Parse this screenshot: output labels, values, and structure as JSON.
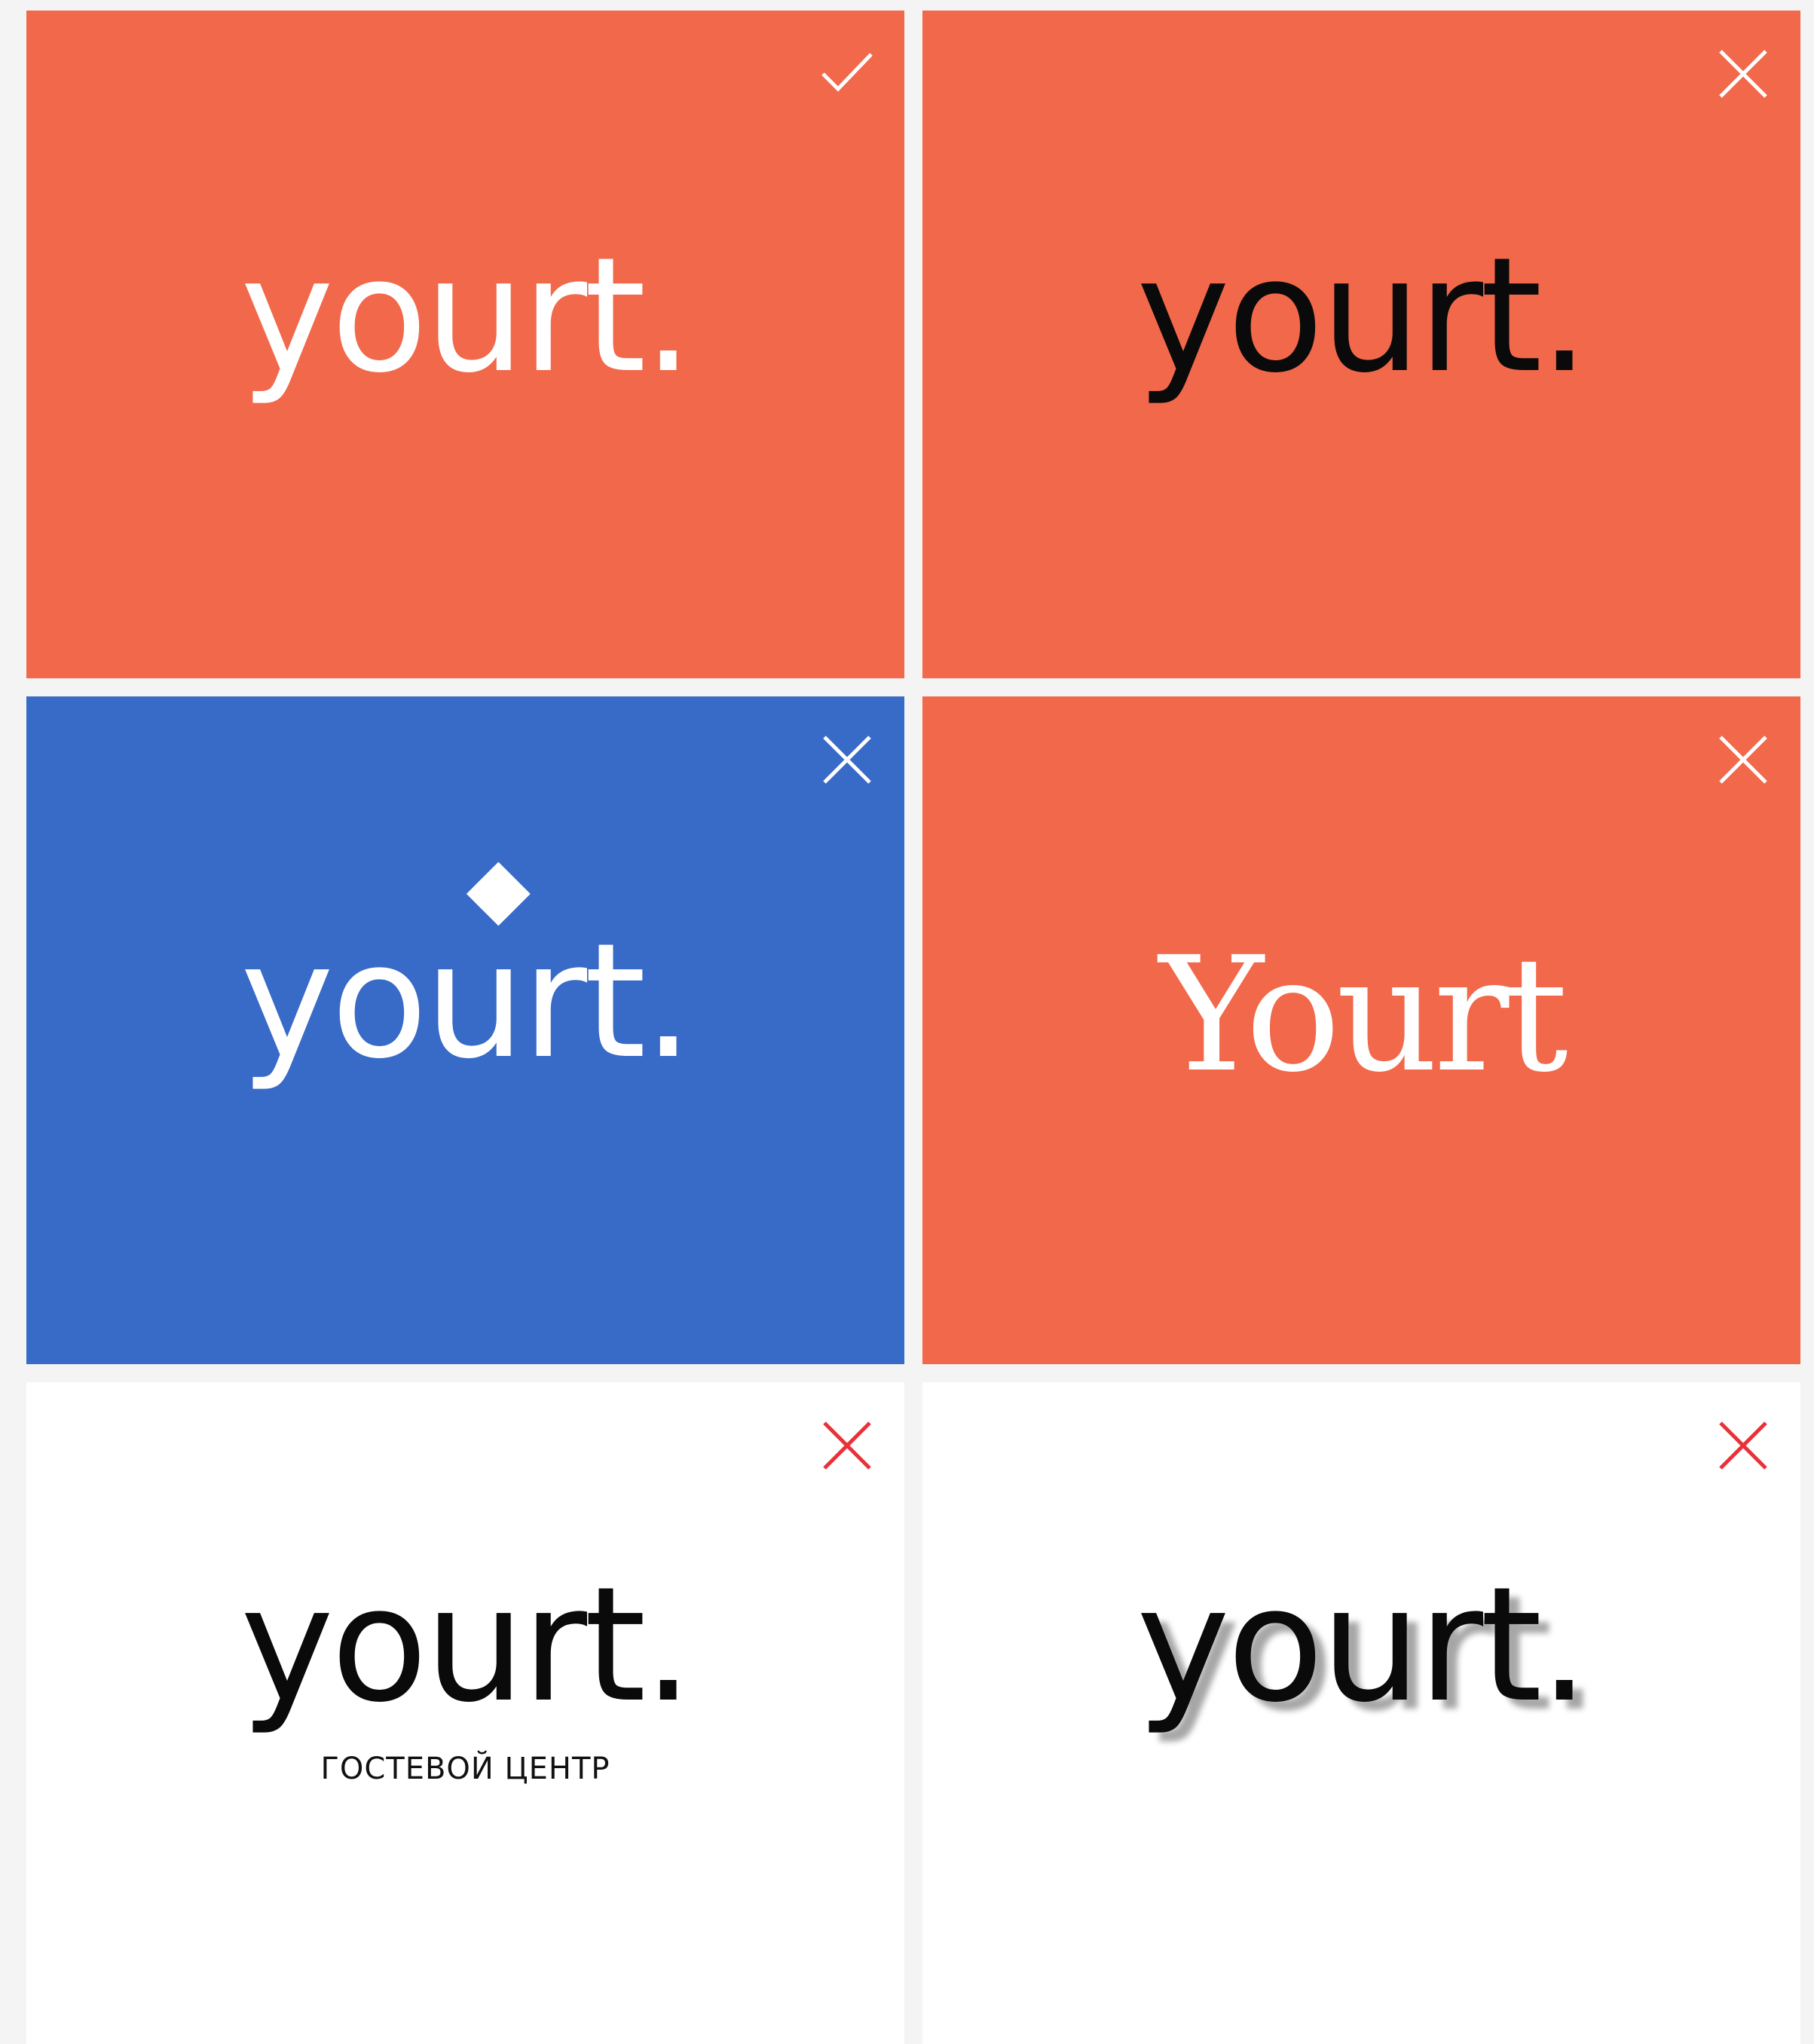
{
  "colors": {
    "orange": "#f2684b",
    "blue": "#386ac7",
    "white": "#ffffff",
    "black": "#0a0a0a",
    "error_red": "#e8323a"
  },
  "panels": [
    {
      "background": "orange",
      "logo_text": "yourt.",
      "logo_color": "white",
      "mark": "check-icon",
      "mark_color": "white"
    },
    {
      "background": "orange",
      "logo_text": "yourt.",
      "logo_color": "black",
      "mark": "close-icon",
      "mark_color": "white"
    },
    {
      "background": "blue",
      "logo_text": "yourt.",
      "logo_color": "white",
      "mark": "close-icon",
      "mark_color": "white",
      "note": "enlarged diamond"
    },
    {
      "background": "orange",
      "logo_text": "Yourt",
      "logo_color": "white",
      "mark": "close-icon",
      "mark_color": "white"
    },
    {
      "background": "white",
      "logo_text": "yourt.",
      "logo_color": "black",
      "subtitle": "ГОСТЕВОЙ ЦЕНТР",
      "mark": "close-icon",
      "mark_color": "error_red"
    },
    {
      "background": "white",
      "logo_text": "yourt.",
      "logo_color": "black",
      "shadow": true,
      "mark": "close-icon",
      "mark_color": "error_red"
    }
  ]
}
